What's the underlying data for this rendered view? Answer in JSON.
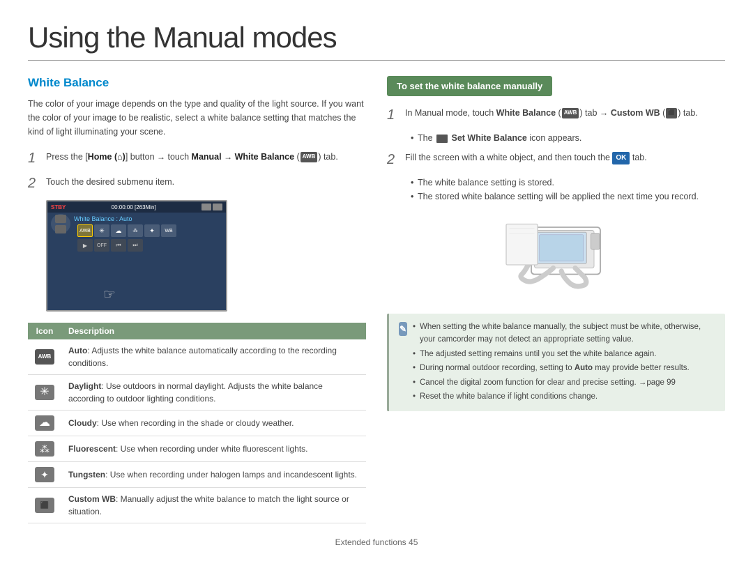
{
  "page": {
    "title": "Using the Manual modes",
    "footer": "Extended functions  45"
  },
  "left": {
    "section_title": "White Balance",
    "intro": "The color of your image depends on the type and quality of the light source. If you want the color of your image to be realistic, select a white balance setting that matches the kind of light illuminating your scene.",
    "steps": [
      {
        "number": "1",
        "text": "Press the [Home (⌂)] button → touch Manual → White Balance (",
        "text2": ") tab."
      },
      {
        "number": "2",
        "text": "Touch the desired submenu item."
      }
    ],
    "camera_screen": {
      "stby": "STBY",
      "time": "00:00:00 [263Min]",
      "wb_label": "White Balance : Auto"
    },
    "table": {
      "col_icon": "Icon",
      "col_desc": "Description",
      "rows": [
        {
          "icon": "AWB",
          "desc_bold": "Auto",
          "desc": ": Adjusts the white balance automatically according to the recording conditions."
        },
        {
          "icon": "✳",
          "desc_bold": "Daylight",
          "desc": ": Use outdoors in normal daylight. Adjusts the white balance according to outdoor lighting conditions."
        },
        {
          "icon": "☁",
          "desc_bold": "Cloudy",
          "desc": ": Use when recording in the shade or cloudy weather."
        },
        {
          "icon": "⁂",
          "desc_bold": "Fluorescent",
          "desc": ": Use when recording under white fluorescent lights."
        },
        {
          "icon": "✦",
          "desc_bold": "Tungsten",
          "desc": ": Use when recording under halogen lamps and incandescent lights."
        },
        {
          "icon": "⬛",
          "desc_bold": "Custom WB",
          "desc": ": Manually adjust the white balance to match the light source or situation."
        }
      ]
    }
  },
  "right": {
    "header": "To set the white balance manually",
    "steps": [
      {
        "number": "1",
        "text_before": "In Manual mode, touch ",
        "bold1": "White Balance (",
        "bold2": ") tab → Custom WB (",
        "bold3": ") tab.",
        "bullet": "The  Set White Balance icon appears."
      },
      {
        "number": "2",
        "text": "Fill the screen with a white object, and then touch the",
        "badge": "OK",
        "text2": "tab.",
        "bullets": [
          "The white balance setting is stored.",
          "The stored white balance setting will be applied the next time you record."
        ]
      }
    ],
    "note": {
      "icon": "✎",
      "bullets": [
        "When setting the white balance manually, the subject must be white, otherwise, your camcorder may not detect an appropriate setting value.",
        "The adjusted setting remains until you set the white balance again.",
        "During normal outdoor recording, setting to Auto may provide better results.",
        "Cancel the digital zoom function for clear and precise setting. →page 99",
        "Reset the white balance if light conditions change."
      ]
    }
  }
}
